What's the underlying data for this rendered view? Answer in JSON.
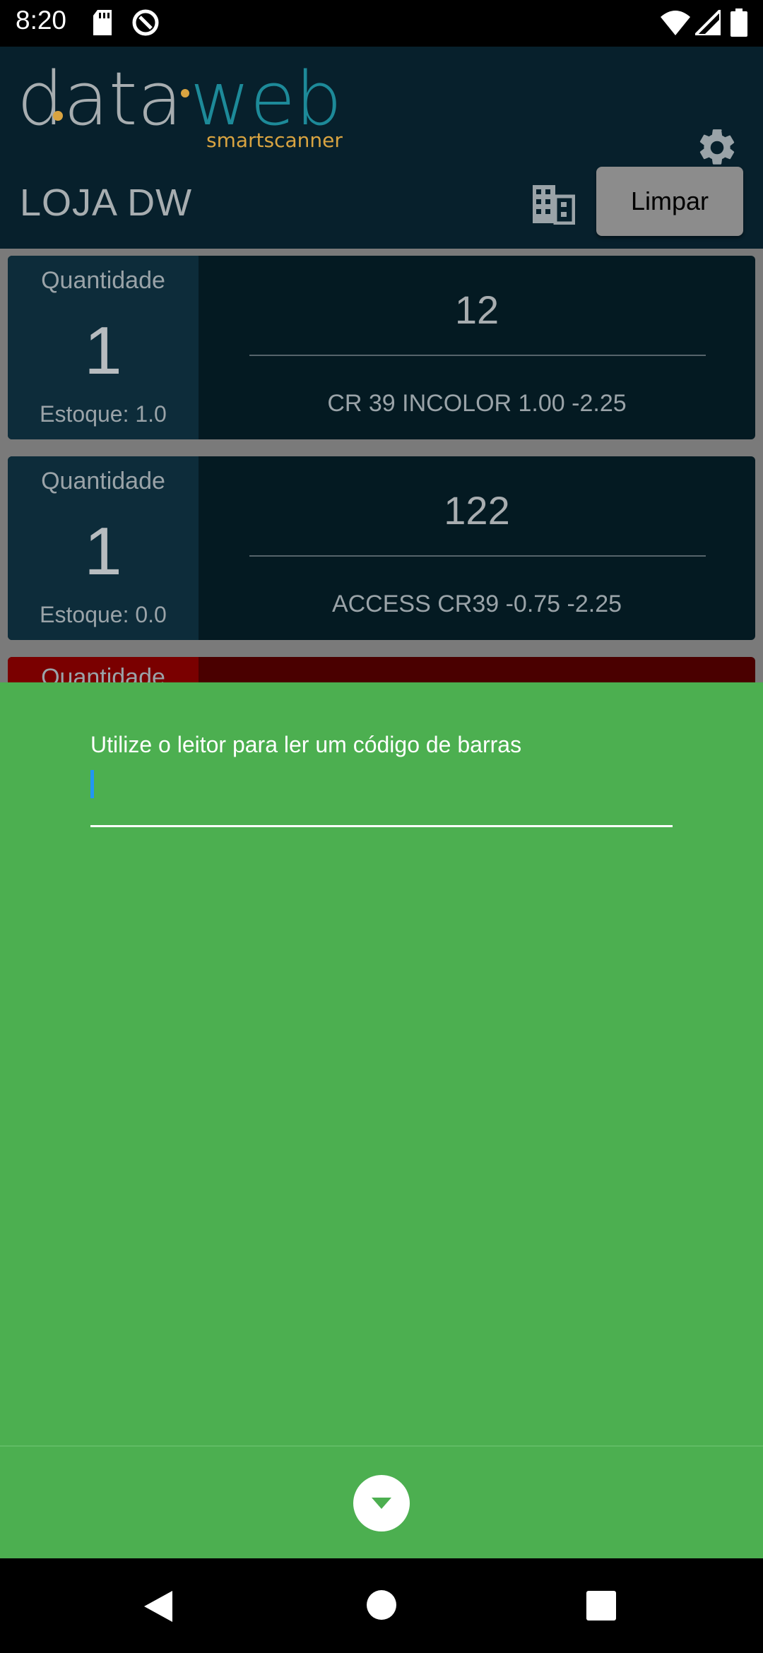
{
  "status_bar": {
    "time": "8:20",
    "icons": [
      "sd-card-icon",
      "vpn-icon",
      "wifi-icon",
      "signal-icon",
      "battery-icon"
    ]
  },
  "app": {
    "logo_text": "dataweb",
    "logo_subtitle": "smartscanner",
    "store_name": "LOJA DW",
    "clear_button": "Limpar",
    "colors": {
      "header_bg": "#07202c",
      "logo_gray": "#a7adb0",
      "logo_teal": "#1d8a99",
      "logo_orange": "#d9a441"
    }
  },
  "items": [
    {
      "quantity_label": "Quantidade",
      "quantity": "1",
      "stock": "Estoque: 1.0",
      "code": "12",
      "description": "CR 39 INCOLOR  1.00 -2.25"
    },
    {
      "quantity_label": "Quantidade",
      "quantity": "1",
      "stock": "Estoque: 0.0",
      "code": "122",
      "description": "ACCESS CR39 -0.75 -2.25"
    },
    {
      "quantity_label": "Quantidade"
    }
  ],
  "scanner_panel": {
    "prompt": "Utilize o leitor para ler um código de barras",
    "input_value": "",
    "background": "#4caf50"
  }
}
